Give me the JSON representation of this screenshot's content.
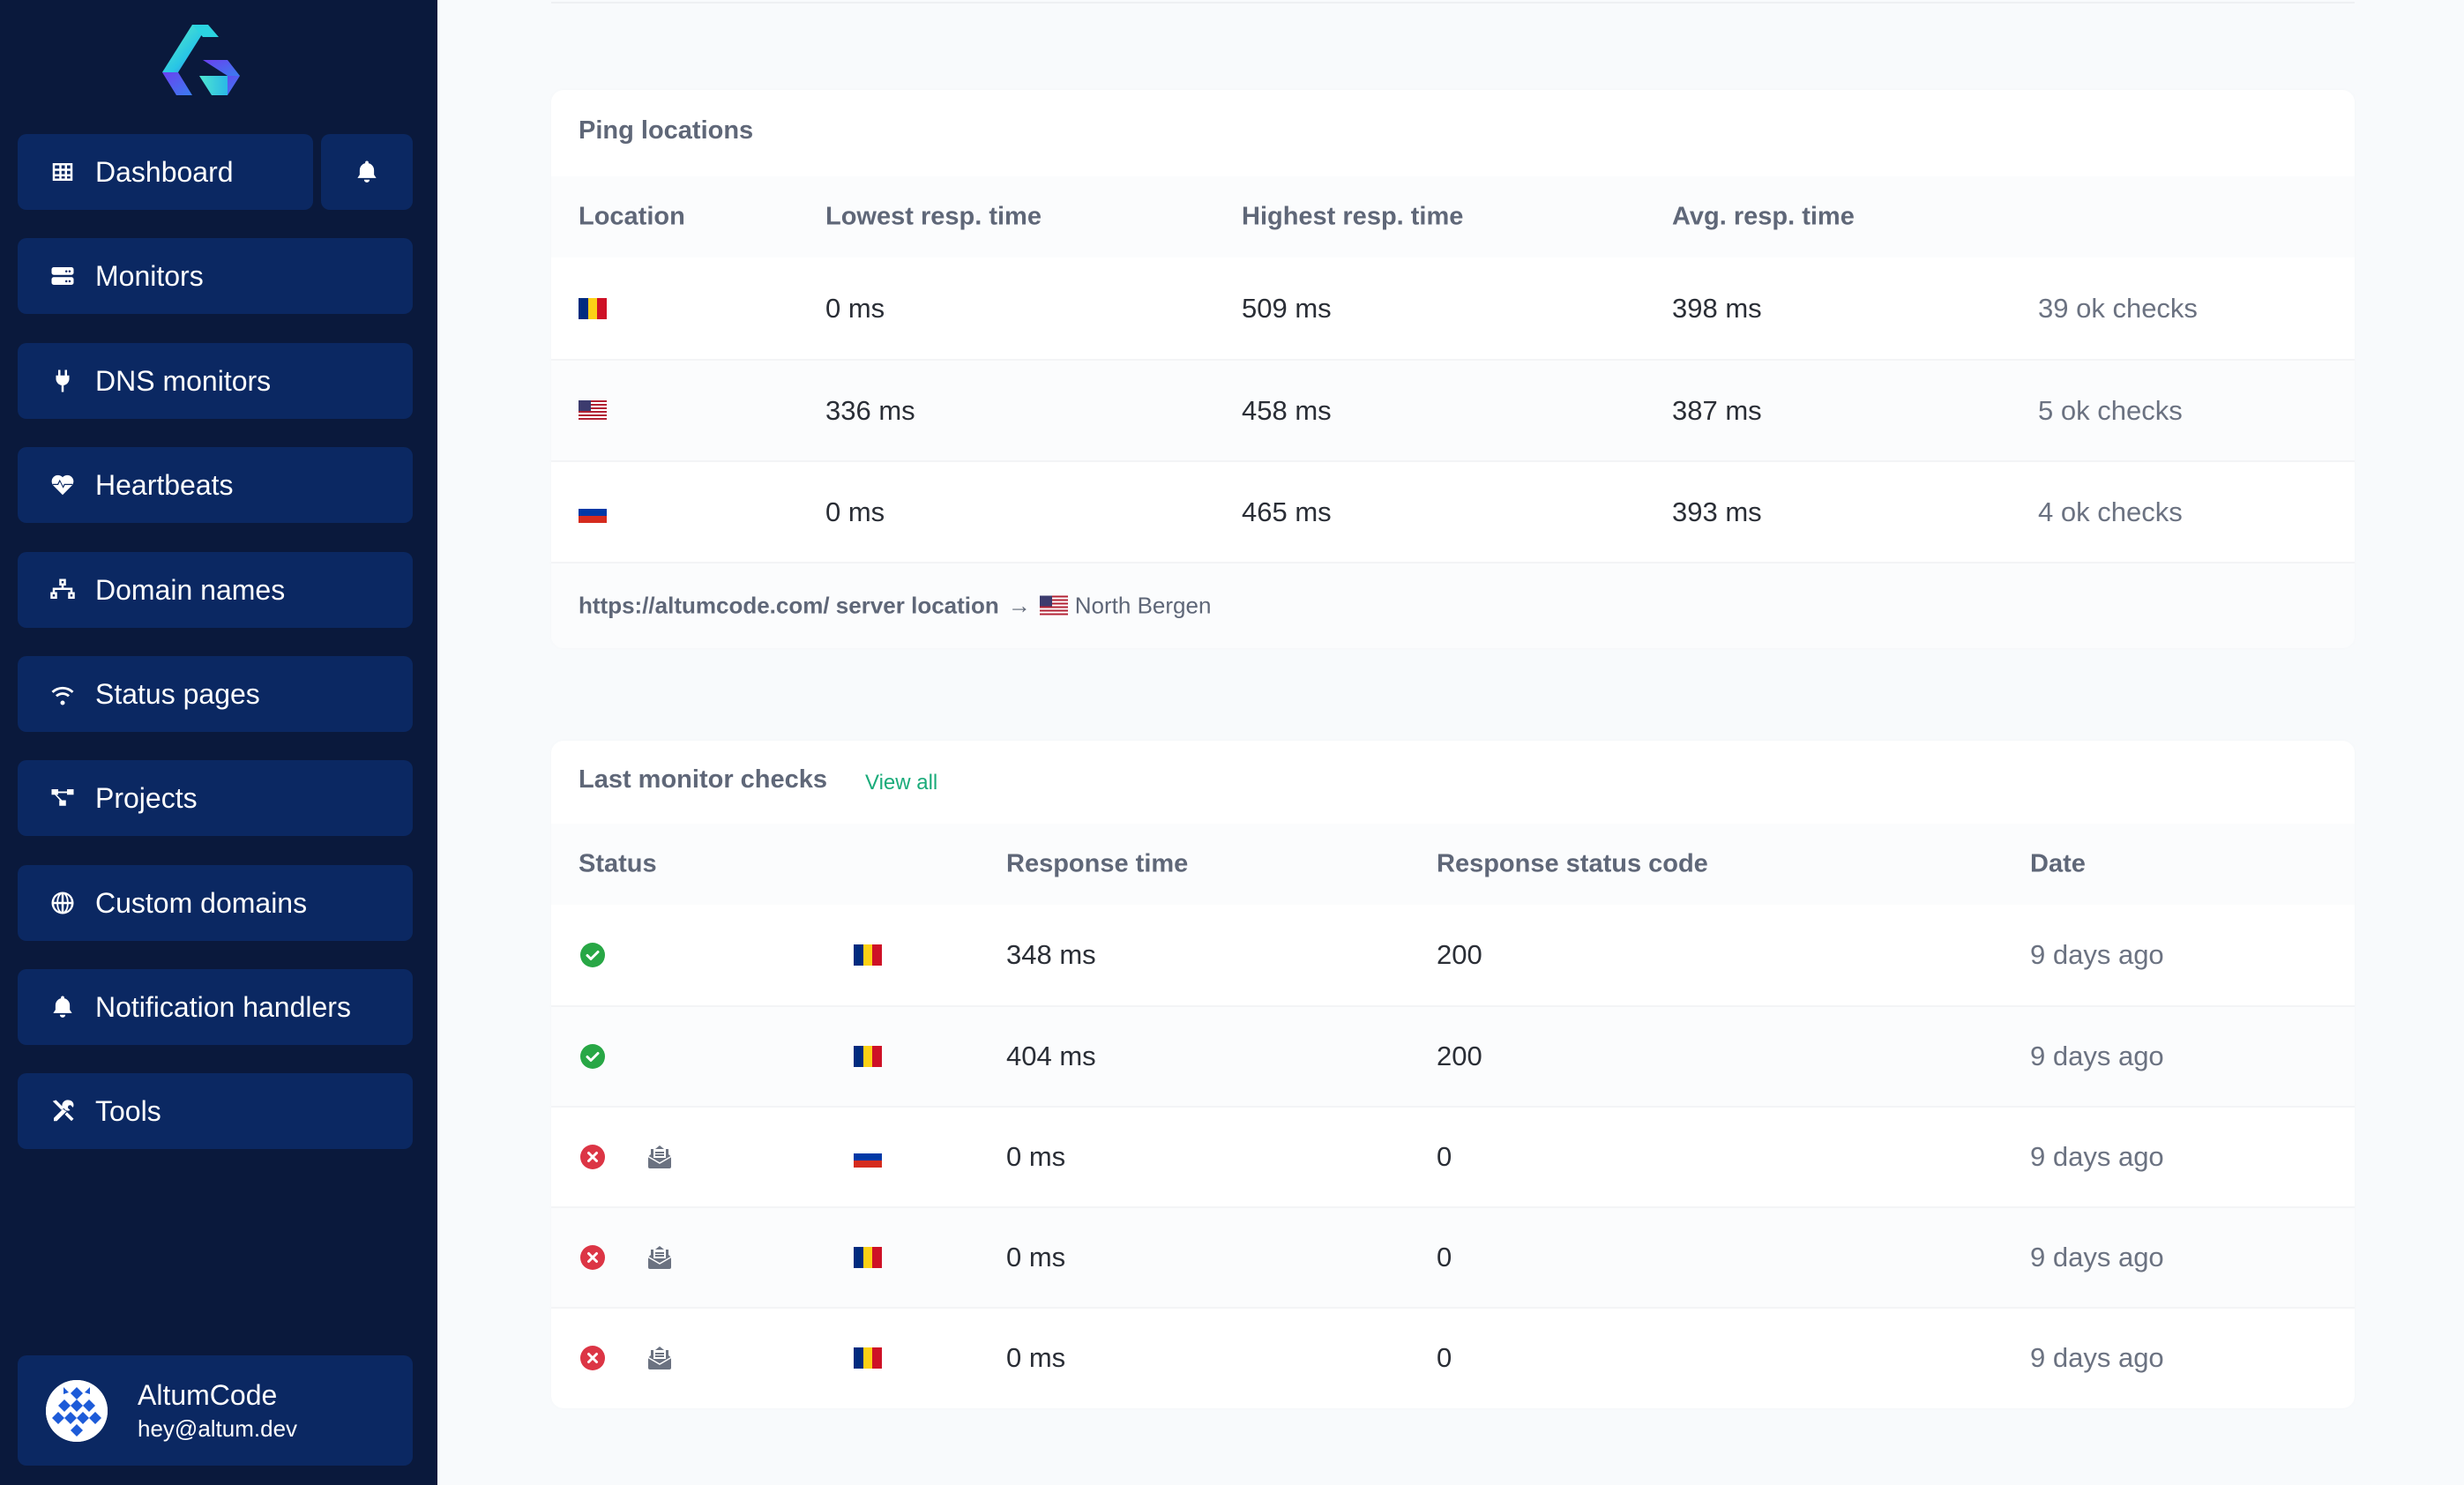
{
  "sidebar": {
    "logo": "altumcode-logo",
    "dashboard_label": "Dashboard",
    "items": [
      {
        "label": "Monitors",
        "icon": "server-icon"
      },
      {
        "label": "DNS monitors",
        "icon": "plug-icon"
      },
      {
        "label": "Heartbeats",
        "icon": "heart-pulse-icon"
      },
      {
        "label": "Domain names",
        "icon": "network-wired-icon"
      },
      {
        "label": "Status pages",
        "icon": "wifi-icon"
      },
      {
        "label": "Projects",
        "icon": "project-diagram-icon"
      },
      {
        "label": "Custom domains",
        "icon": "globe-icon"
      },
      {
        "label": "Notification handlers",
        "icon": "bell-icon"
      },
      {
        "label": "Tools",
        "icon": "tools-icon"
      }
    ],
    "user": {
      "name": "AltumCode",
      "email": "hey@altum.dev"
    }
  },
  "ping_locations": {
    "title": "Ping locations",
    "columns": [
      "Location",
      "Lowest resp. time",
      "Highest resp. time",
      "Avg. resp. time",
      ""
    ],
    "rows": [
      {
        "flag": "RO",
        "lowest": "0 ms",
        "highest": "509 ms",
        "avg": "398 ms",
        "checks": "39 ok checks"
      },
      {
        "flag": "US",
        "lowest": "336 ms",
        "highest": "458 ms",
        "avg": "387 ms",
        "checks": "5 ok checks"
      },
      {
        "flag": "RU",
        "lowest": "0 ms",
        "highest": "465 ms",
        "avg": "393 ms",
        "checks": "4 ok checks"
      }
    ],
    "server_location": {
      "url_label": "https://altumcode.com/ server location",
      "arrow": "→",
      "flag": "US",
      "city": "North Bergen"
    }
  },
  "last_checks": {
    "title": "Last monitor checks",
    "view_all": "View all",
    "columns": [
      "Status",
      "",
      "Response time",
      "Response status code",
      "Date"
    ],
    "rows": [
      {
        "status": "ok",
        "notified": false,
        "flag": "RO",
        "response_time": "348 ms",
        "status_code": "200",
        "date": "9 days ago"
      },
      {
        "status": "ok",
        "notified": false,
        "flag": "RO",
        "response_time": "404 ms",
        "status_code": "200",
        "date": "9 days ago"
      },
      {
        "status": "error",
        "notified": true,
        "flag": "RU",
        "response_time": "0 ms",
        "status_code": "0",
        "date": "9 days ago"
      },
      {
        "status": "error",
        "notified": true,
        "flag": "RO",
        "response_time": "0 ms",
        "status_code": "0",
        "date": "9 days ago"
      },
      {
        "status": "error",
        "notified": true,
        "flag": "RO",
        "response_time": "0 ms",
        "status_code": "0",
        "date": "9 days ago"
      }
    ]
  },
  "colors": {
    "sidebar_bg": "#0a193c",
    "nav_item_bg": "#0b2862",
    "ok": "#28a745",
    "error": "#dc3545",
    "link": "#1aab7a",
    "flag_ro": [
      "#002b7f",
      "#fcd116",
      "#ce1126"
    ],
    "flag_ru": [
      "#ffffff",
      "#0039a6",
      "#d52b1e"
    ]
  }
}
